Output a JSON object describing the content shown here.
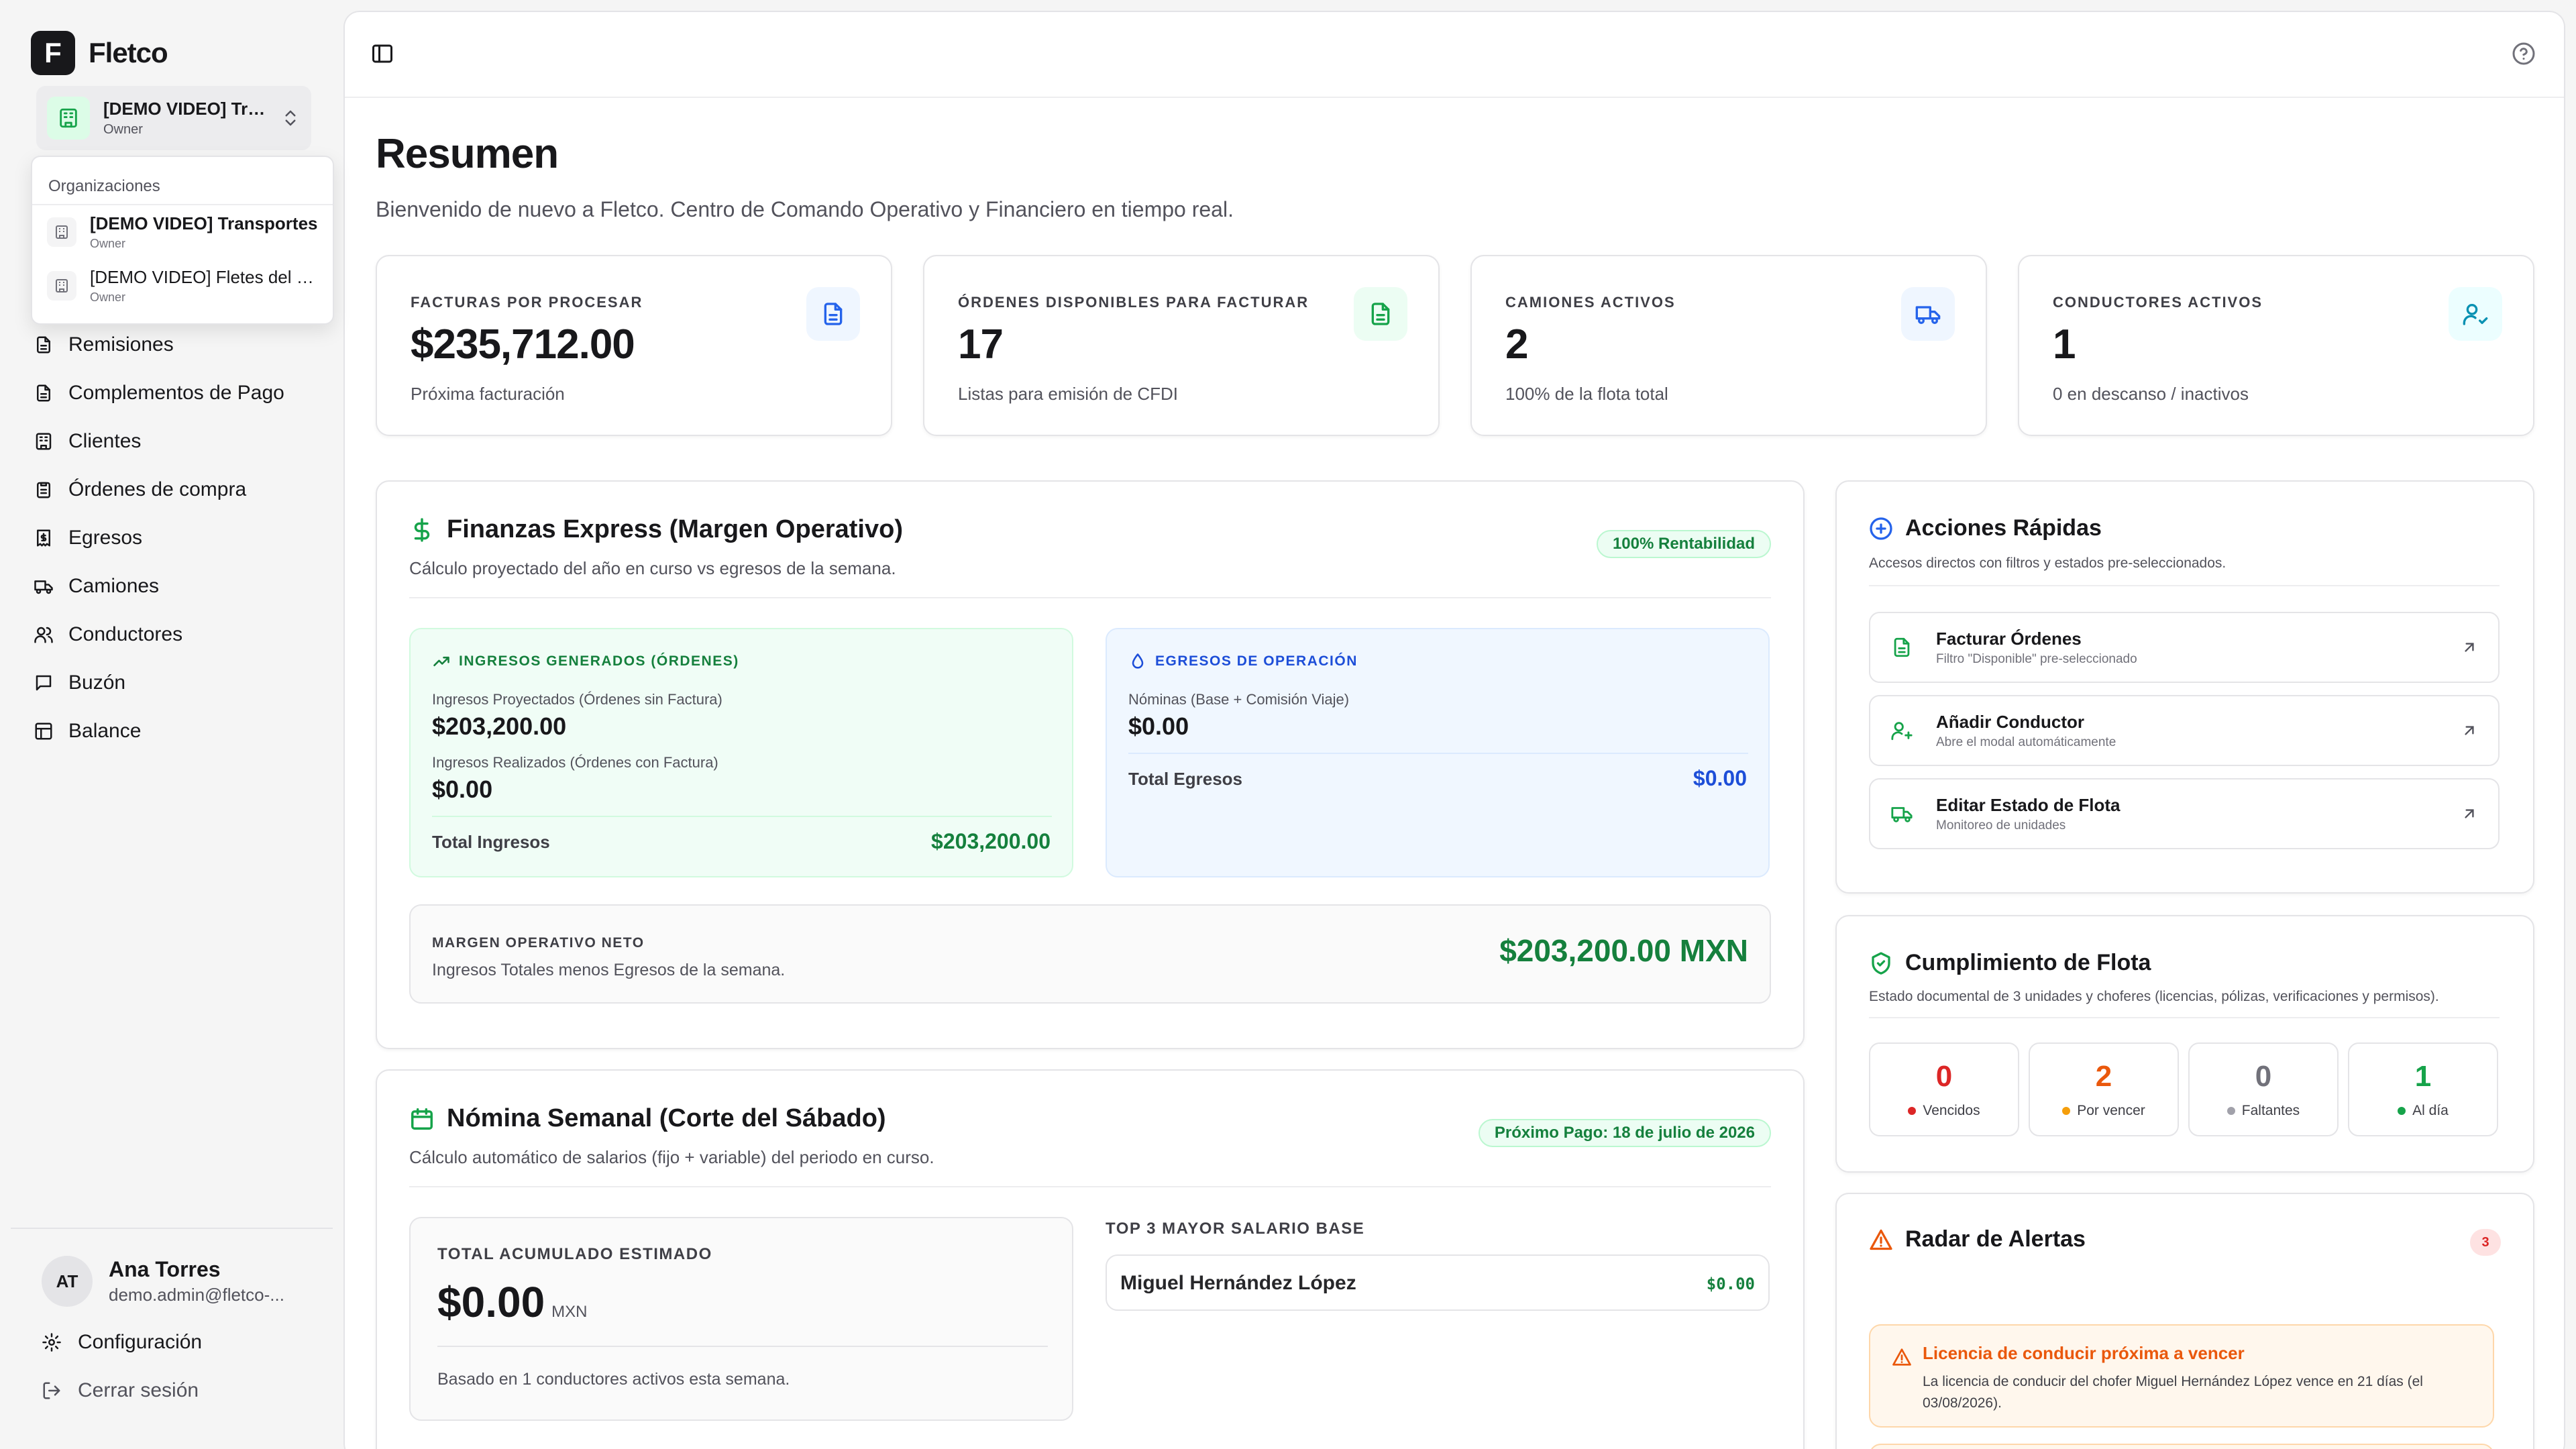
{
  "brand": {
    "logo_letter": "F",
    "name": "Fletco"
  },
  "org_switcher": {
    "title": "[DEMO VIDEO] Transportes",
    "role": "Owner"
  },
  "org_dropdown": {
    "label": "Organizaciones",
    "items": [
      {
        "name": "[DEMO VIDEO] Transportes",
        "role": "Owner"
      },
      {
        "name": "[DEMO VIDEO] Fletes del Norte",
        "role": "Owner"
      }
    ]
  },
  "nav": {
    "items": [
      {
        "label": "Remisiones",
        "icon": "file-icon"
      },
      {
        "label": "Complementos de Pago",
        "icon": "file-icon"
      },
      {
        "label": "Clientes",
        "icon": "building-icon"
      },
      {
        "label": "Órdenes de compra",
        "icon": "clipboard-icon"
      },
      {
        "label": "Egresos",
        "icon": "receipt-icon"
      },
      {
        "label": "Camiones",
        "icon": "truck-icon"
      },
      {
        "label": "Conductores",
        "icon": "users-icon"
      },
      {
        "label": "Buzón",
        "icon": "message-icon"
      },
      {
        "label": "Balance",
        "icon": "balance-icon"
      }
    ]
  },
  "user": {
    "initials": "AT",
    "name": "Ana Torres",
    "email": "demo.admin@fletco-..."
  },
  "sidebar_links": {
    "settings": "Configuración",
    "logout": "Cerrar sesión"
  },
  "page": {
    "title": "Resumen",
    "subtitle": "Bienvenido de nuevo a Fletco. Centro de Comando Operativo y Financiero en tiempo real."
  },
  "stats": [
    {
      "label": "FACTURAS POR PROCESAR",
      "value": "$235,712.00",
      "sub": "Próxima facturación",
      "icon": "file-text-icon",
      "color": "#2563eb",
      "bg": "#eff6ff"
    },
    {
      "label": "ÓRDENES DISPONIBLES PARA FACTURAR",
      "value": "17",
      "sub": "Listas para emisión de CFDI",
      "icon": "file-text-icon",
      "color": "#16a34a",
      "bg": "#ecfdf3"
    },
    {
      "label": "CAMIONES ACTIVOS",
      "value": "2",
      "sub": "100% de la flota total",
      "icon": "truck-icon",
      "color": "#2563eb",
      "bg": "#eff6ff"
    },
    {
      "label": "CONDUCTORES ACTIVOS",
      "value": "1",
      "sub": "0 en descanso / inactivos",
      "icon": "user-check-icon",
      "color": "#0891b2",
      "bg": "#ecfeff"
    }
  ],
  "finanzas": {
    "title": "Finanzas Express (Margen Operativo)",
    "subtitle": "Cálculo proyectado del año en curso vs egresos de la semana.",
    "badge": "100% Rentabilidad",
    "ingresos": {
      "label": "INGRESOS GENERADOS (ÓRDENES)",
      "proj_label": "Ingresos Proyectados (Órdenes sin Factura)",
      "proj_value": "$203,200.00",
      "real_label": "Ingresos Realizados (Órdenes con Factura)",
      "real_value": "$0.00",
      "total_label": "Total Ingresos",
      "total_value": "$203,200.00"
    },
    "egresos": {
      "label": "EGRESOS DE OPERACIÓN",
      "nom_label": "Nóminas (Base + Comisión Viaje)",
      "nom_value": "$0.00",
      "total_label": "Total Egresos",
      "total_value": "$0.00"
    },
    "margen": {
      "label": "MARGEN OPERATIVO NETO",
      "sub": "Ingresos Totales menos Egresos de la semana.",
      "value": "$203,200.00 MXN"
    }
  },
  "nomina": {
    "title": "Nómina Semanal (Corte del Sábado)",
    "subtitle": "Cálculo automático de salarios (fijo + variable) del periodo en curso.",
    "badge": "Próximo Pago: 18 de julio de 2026",
    "total_label": "TOTAL ACUMULADO ESTIMADO",
    "total_value": "$0.00",
    "total_currency": "MXN",
    "note": "Basado en 1 conductores activos esta semana.",
    "top_label": "TOP 3 MAYOR SALARIO BASE",
    "top": [
      {
        "name": "Miguel Hernández López",
        "amount": "$0.00"
      }
    ]
  },
  "acciones": {
    "title": "Acciones Rápidas",
    "subtitle": "Accesos directos con filtros y estados pre-seleccionados.",
    "items": [
      {
        "title": "Facturar Órdenes",
        "sub": "Filtro \"Disponible\" pre-seleccionado",
        "icon": "file-text-icon"
      },
      {
        "title": "Añadir Conductor",
        "sub": "Abre el modal automáticamente",
        "icon": "user-plus-icon"
      },
      {
        "title": "Editar Estado de Flota",
        "sub": "Monitoreo de unidades",
        "icon": "truck-icon"
      }
    ]
  },
  "cumplimiento": {
    "title": "Cumplimiento de Flota",
    "subtitle": "Estado documental de 3 unidades y choferes (licencias, pólizas, verificaciones y permisos).",
    "items": [
      {
        "value": "0",
        "label": "Vencidos",
        "color": "#dc2626"
      },
      {
        "value": "2",
        "label": "Por vencer",
        "color": "#ea580c"
      },
      {
        "value": "0",
        "label": "Faltantes",
        "color": "#a1a1aa"
      },
      {
        "value": "1",
        "label": "Al día",
        "color": "#16a34a"
      }
    ]
  },
  "alertas": {
    "title": "Radar de Alertas",
    "count": "3",
    "items": [
      {
        "title": "Licencia de conducir próxima a vencer",
        "body": "La licencia de conducir del chofer Miguel Hernández López vence en 21 días (el 03/08/2026)."
      }
    ]
  }
}
